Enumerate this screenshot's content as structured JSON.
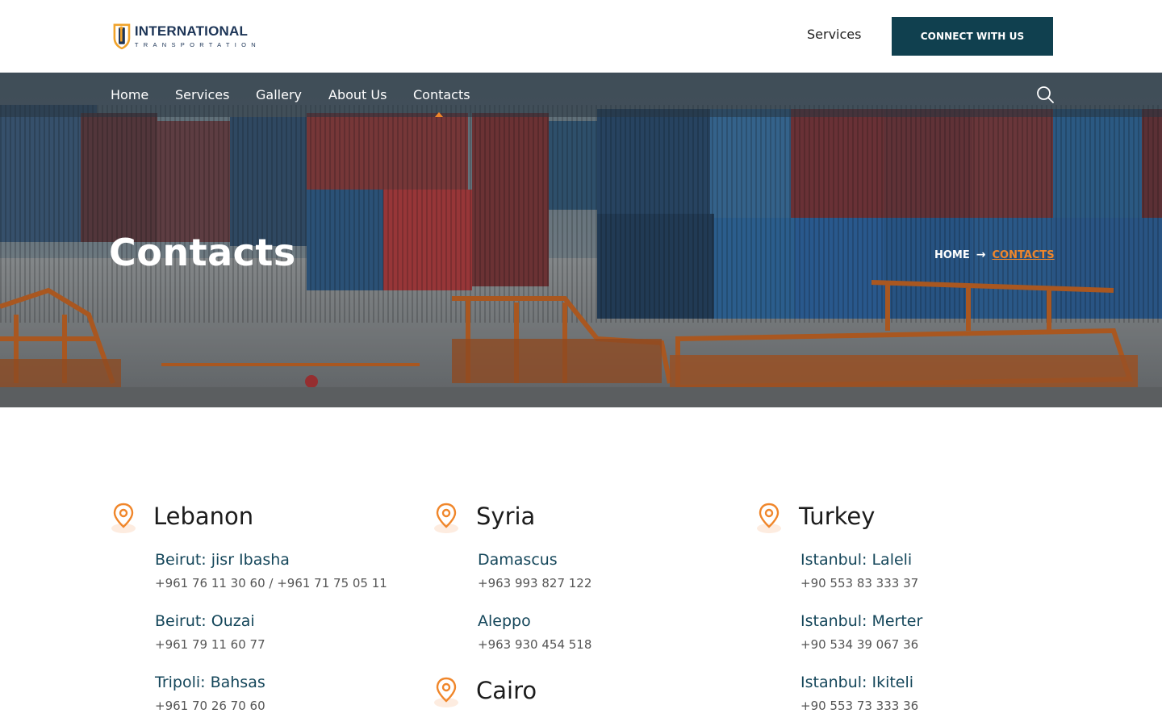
{
  "header": {
    "logo": {
      "main": "INTERNATIONAL",
      "sub": "TRANSPORTATION"
    },
    "top_link": "Services",
    "cta": "CONNECT WITH US"
  },
  "nav": {
    "items": [
      "Home",
      "Services",
      "Gallery",
      "About Us",
      "Contacts"
    ],
    "active": "Contacts"
  },
  "hero": {
    "title": "Contacts",
    "breadcrumb": {
      "home": "HOME",
      "arrow": "→",
      "current": "CONTACTS"
    }
  },
  "colors": {
    "accent": "#f0862a",
    "primary": "#10404f",
    "city": "#14465a"
  },
  "regions": [
    {
      "name": "Lebanon",
      "offices": [
        {
          "city": "Beirut: jisr Ibasha",
          "phone": "+961 76 11 30 60  / +961 71 75 05 11"
        },
        {
          "city": "Beirut: Ouzai",
          "phone": "+961 79 11 60 77"
        },
        {
          "city": "Tripoli: Bahsas",
          "phone": "+961 70 26 70 60"
        }
      ]
    },
    {
      "name": "Syria",
      "offices": [
        {
          "city": "Damascus",
          "phone": "+963 993 827 122"
        },
        {
          "city": "Aleppo",
          "phone": "+963 930 454 518"
        }
      ]
    },
    {
      "name": "Cairo",
      "offices": []
    },
    {
      "name": "Turkey",
      "offices": [
        {
          "city": "Istanbul: Laleli",
          "phone": "+90 553 83 333 37"
        },
        {
          "city": "Istanbul: Merter",
          "phone": "+90 534 39 067 36"
        },
        {
          "city": "Istanbul: Ikiteli",
          "phone": "+90 553 73 333 36"
        }
      ]
    }
  ]
}
